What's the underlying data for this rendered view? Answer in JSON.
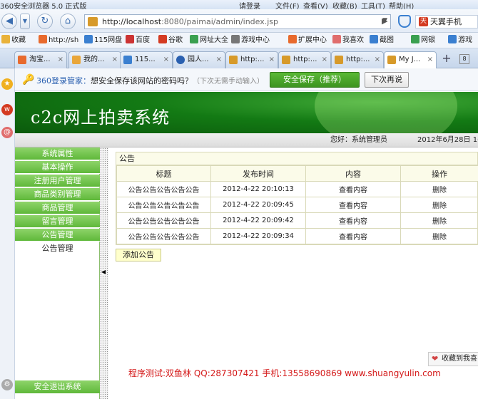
{
  "browser": {
    "title": "360安全浏览器 5.0 正式版",
    "login": "请登录",
    "menus": [
      "文件(F)",
      "查看(V)",
      "收藏(B)",
      "工具(T)",
      "帮助(H)"
    ],
    "url_host": "http://localhost",
    "url_rest": ":8080/paimai/admin/index.jsp",
    "phone_label": "天翼手机",
    "favorites": [
      "收藏",
      "http://sh",
      "115网盘",
      "百度",
      "谷歌",
      "网址大全",
      "游戏中心",
      "扩展中心",
      "我喜欢",
      "截图",
      "网银",
      "游戏"
    ],
    "tabs": [
      "淘宝...",
      "我的...",
      "115...",
      "园人...",
      "http:...",
      "http:...",
      "http:...",
      "My J..."
    ],
    "new_tab": "+"
  },
  "password_bar": {
    "brand": "360登录管家：",
    "message": "想安全保存该网站的密码吗？",
    "hint": "（下次无需手动输入）",
    "save_label": "安全保存（推荐）",
    "later_label": "下次再说"
  },
  "header": {
    "site_title": "c2c网上拍卖系统",
    "greeting": "您好：系统管理员",
    "date": "2012年6月28日  16:0"
  },
  "sidebar": {
    "items": [
      "系统属性",
      "基本操作",
      "注册用户管理",
      "商品类别管理",
      "商品管理",
      "留言管理",
      "公告管理"
    ],
    "sub_item": "公告管理",
    "exit_label": "安全退出系统"
  },
  "notice": {
    "panel_title": "公告",
    "columns": [
      "标题",
      "发布时间",
      "内容",
      "操作"
    ],
    "rows": [
      {
        "title": "公告公告公告公告公告",
        "time": "2012-4-22 20:10:13",
        "content": "查看内容",
        "action": "删除"
      },
      {
        "title": "公告公告公告公告公告",
        "time": "2012-4-22 20:09:45",
        "content": "查看内容",
        "action": "删除"
      },
      {
        "title": "公告公告公告公告公告",
        "time": "2012-4-22 20:09:42",
        "content": "查看内容",
        "action": "删除"
      },
      {
        "title": "公告公告公告公告公告",
        "time": "2012-4-22 20:09:34",
        "content": "查看内容",
        "action": "删除"
      }
    ],
    "add_label": "添加公告"
  },
  "footer": {
    "credit": "程序测试:双鱼林 QQ:287307421 手机:13558690869 www.shuangyulin.com",
    "collect_label": "收藏到我喜"
  },
  "colors": {
    "menu_green": "#5fb83a",
    "banner_green": "#137a14",
    "credit_red": "#d41818",
    "save_green": "#3d9420"
  }
}
